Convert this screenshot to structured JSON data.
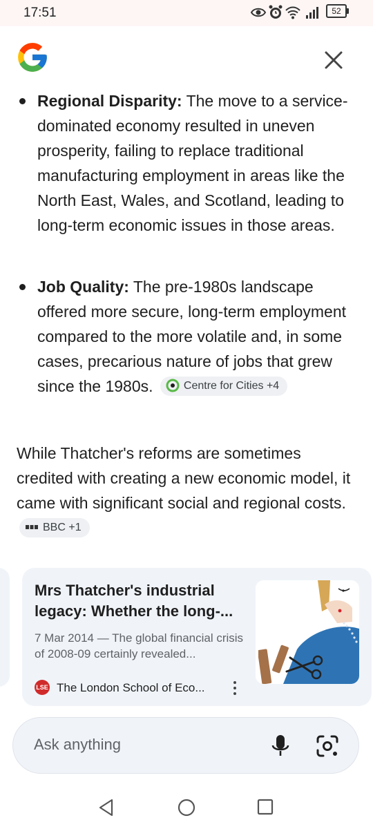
{
  "status_bar": {
    "time": "17:51",
    "battery": "52",
    "icons": [
      "eye-icon",
      "alarm-icon",
      "wifi-icon",
      "signal-icon",
      "battery-icon"
    ]
  },
  "header": {
    "logo": "google-g-logo",
    "close_icon": "close-icon"
  },
  "bullets": [
    {
      "term": "Regional Disparity:",
      "text": " The move to a service-dominated economy resulted in uneven prosperity, failing to replace traditional manufacturing employment in areas like the North East, Wales, and Scotland, leading to long-term economic issues in those areas."
    },
    {
      "term": "Job Quality:",
      "text": " The pre-1980s landscape offered more secure, long-term employment compared to the more volatile and, in some cases, precarious nature of jobs that grew since the 1980s.",
      "chip": "Centre for Cities +4"
    }
  ],
  "paragraph": {
    "text": "While Thatcher's reforms are sometimes credited with creating a new economic model, it came with significant social and regional costs.",
    "chip": "BBC +1"
  },
  "card": {
    "title": "Mrs Thatcher's industrial legacy: Whether the long-...",
    "snippet": "7 Mar 2014 — The global financial crisis of 2008-09 certainly revealed...",
    "source_logo": "LSE",
    "source": "The London School of Eco...",
    "more_icon": "more-vert-icon"
  },
  "input": {
    "placeholder": "Ask anything",
    "mic_icon": "mic-icon",
    "lens_icon": "lens-icon"
  },
  "nav": {
    "back_icon": "back-triangle-icon",
    "home_icon": "home-circle-icon",
    "recents_icon": "recents-square-icon"
  },
  "colors": {
    "card_bg": "#f0f4f9",
    "chip_bg": "#eef0f3",
    "text": "#1f1f1f",
    "muted": "#5f6368",
    "lse_red": "#d02b2b"
  }
}
